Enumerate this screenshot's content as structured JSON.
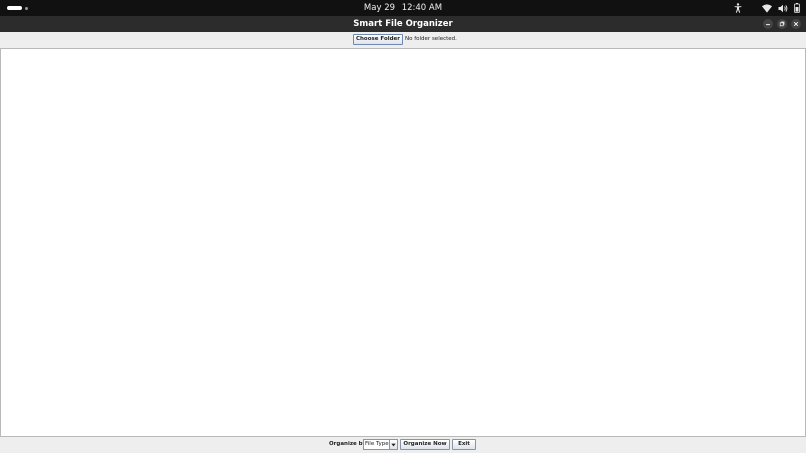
{
  "system": {
    "date": "May 29",
    "time": "12:40 AM",
    "tray_icons": [
      "accessibility-icon",
      "wifi-icon",
      "volume-icon",
      "battery-icon"
    ]
  },
  "window": {
    "title": "Smart File Organizer"
  },
  "toolbar": {
    "choose_folder_label": "Choose Folder",
    "folder_status": "No folder selected."
  },
  "bottom": {
    "organize_by_label": "Organize by:",
    "organize_by_selected": "File Type",
    "organize_now_label": "Organize Now",
    "exit_label": "Exit"
  },
  "colors": {
    "top_bar": "#111111",
    "title_bar": "#2c2c2c",
    "app_bg": "#eeeeee",
    "content_bg": "#ffffff"
  }
}
